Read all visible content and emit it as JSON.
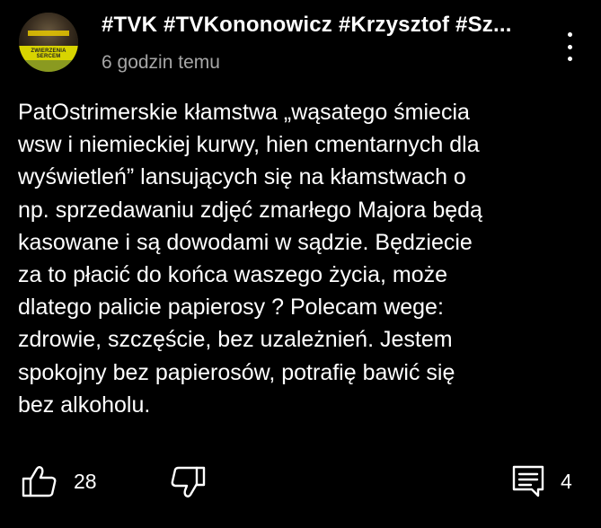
{
  "comment": {
    "author": "#TVK #TVKononowicz #Krzysztof #Sz...",
    "timestamp": "6 godzin temu",
    "avatar_text": "ZWIERZENIA SERCEM",
    "body": "PatOstrimerskie kłamstwa „wąsatego śmiecia\nwsw i niemieckiej kurwy, hien cmentarnych dla\nwyświetleń” lansujących się na kłamstwach o\nnp. sprzedawaniu zdjęć zmarłego Majora będą\nkasowane i są dowodami w sądzie. Będziecie\nza to płacić do końca waszego życia, może\ndlatego palicie papierosy ? Polecam wege:\nzdrowie, szczęście, bez uzależnień. Jestem\nspokojny bez papierosów, potrafię bawić się\nbez alkoholu.",
    "likes": "28",
    "replies": "4"
  },
  "icons": {
    "more": "more-vert-icon",
    "like": "thumb-up-icon",
    "dislike": "thumb-down-icon",
    "reply": "comment-icon"
  },
  "colors": {
    "background": "#000000",
    "text": "#ffffff",
    "secondary_text": "#a6a6a6"
  }
}
